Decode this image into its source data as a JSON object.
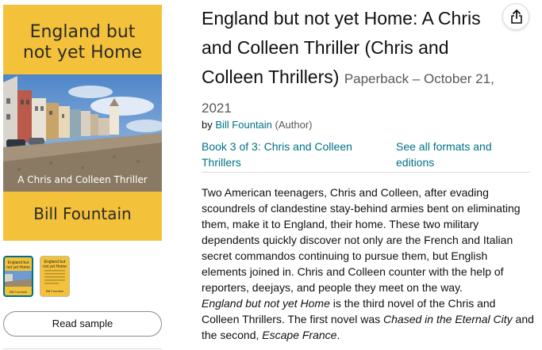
{
  "cover": {
    "title": "England but\nnot yet Home",
    "tagline": "A Chris and Colleen Thriller",
    "author": "Bill Fountain"
  },
  "thumbnails": [
    {
      "title": "England but\nnot yet Home",
      "author": "Bill Fountain"
    },
    {
      "title": "England but\nnot yet Home",
      "author": "Bill Fountain"
    }
  ],
  "read_sample_label": "Read sample",
  "product": {
    "title_line1": "England but not yet Home: A Chris",
    "title_line2": "and Colleen Thriller (Chris and",
    "title_line3": "Colleen Thrillers)",
    "format": "Paperback – October 21,",
    "format_year": "2021",
    "by_prefix": "by",
    "author": "Bill Fountain",
    "author_role": "(Author)",
    "series_line1": "Book 3 of 3: Chris and Colleen",
    "series_line2": "Thrillers",
    "formats_line1": "See all formats and",
    "formats_line2": "editions"
  },
  "description": {
    "paragraph1": "Two American teenagers, Chris and Colleen, after evading scoundrels of clandestine stay-behind armies bent on eliminating them, make it to England, their home. These two military dependents quickly discover not only are the French and Italian secret commandos continuing to pursue them, but English elements joined in. Chris and Colleen counter with the help of reporters, deejays, and people they meet on the way.",
    "p2_italic1": "England but not yet Home",
    "p2_text1": " is the third novel of the Chris and Colleen Thrillers. The first novel was ",
    "p2_italic2": "Chased in the Eternal City",
    "p2_text2": " and the second, ",
    "p2_italic3": "Escape France",
    "p2_text3": "."
  },
  "colors": {
    "cover_yellow": "#f3c13a",
    "link": "#007185",
    "secondary_text": "#565959"
  },
  "icons": {
    "share": "share-icon"
  }
}
